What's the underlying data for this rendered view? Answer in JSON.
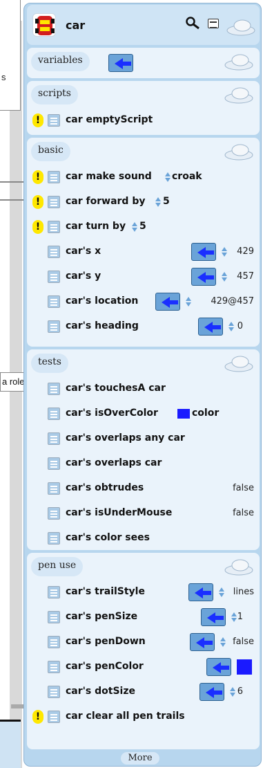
{
  "background": {
    "frame_text": "s",
    "role_text": "a role"
  },
  "viewer": {
    "object_name": "car",
    "icons": {
      "thumbnail": "car-thumbnail-icon",
      "search": "search-icon",
      "menu": "menu-icon",
      "collapse": "collapse-cloud-icon"
    },
    "variables": {
      "label": "variables"
    },
    "scripts": {
      "label": "scripts",
      "items": [
        {
          "label": "car emptyScript",
          "bang": "!"
        }
      ]
    },
    "basic": {
      "label": "basic",
      "rows": [
        {
          "label": "car make sound",
          "value": "croak",
          "bang": "!"
        },
        {
          "label": "car forward by",
          "value": "5",
          "bang": "!"
        },
        {
          "label": "car turn by",
          "value": "5",
          "bang": "!"
        },
        {
          "label": "car's x",
          "value": "429"
        },
        {
          "label": "car's y",
          "value": "457"
        },
        {
          "label": "car's location",
          "value": "429@457"
        },
        {
          "label": "car's heading",
          "value": "0"
        }
      ]
    },
    "tests": {
      "label": "tests",
      "rows": [
        {
          "label": "car's touchesA car"
        },
        {
          "label": "car's isOverColor",
          "suffix": "color",
          "color": "#1a1aff"
        },
        {
          "label": "car's overlaps any car"
        },
        {
          "label": "car's overlaps car"
        },
        {
          "label": "car's obtrudes",
          "value": "false"
        },
        {
          "label": "car's isUnderMouse",
          "value": "false"
        },
        {
          "label": "car's color  sees"
        }
      ]
    },
    "pen_use": {
      "label": "pen use",
      "rows": [
        {
          "label": "car's trailStyle",
          "value": "lines"
        },
        {
          "label": "car's penSize",
          "value": "1"
        },
        {
          "label": "car's penDown",
          "value": "false"
        },
        {
          "label": "car's penColor",
          "color": "#1a1aff"
        },
        {
          "label": "car's dotSize",
          "value": "6"
        },
        {
          "label": "car clear all pen trails",
          "bang": "!"
        }
      ]
    },
    "more_label": "More"
  },
  "colors": {
    "panel": "#b7d6ee",
    "section": "#eaf3fb",
    "bang": "#ffe800",
    "arrow": "#6aa3d8"
  }
}
